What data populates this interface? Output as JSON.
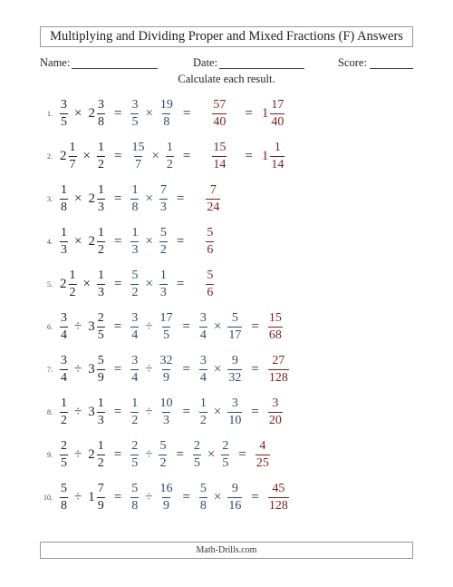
{
  "title": "Multiplying and Dividing Proper and Mixed Fractions (F) Answers",
  "header": {
    "name_label": "Name:",
    "date_label": "Date:",
    "score_label": "Score:"
  },
  "instructions": "Calculate each result.",
  "footer": "Math-Drills.com",
  "colors": {
    "problem": "#222222",
    "step": "#2e4a6b",
    "answer": "#7a1f1f"
  },
  "problems": [
    {
      "number": "1.",
      "segments": [
        {
          "type": "problem",
          "items": [
            {
              "f": [
                "3",
                "5"
              ]
            },
            {
              "op": "×"
            },
            {
              "w": "2",
              "f": [
                "3",
                "8"
              ]
            }
          ]
        },
        {
          "type": "step",
          "items": [
            {
              "f": [
                "3",
                "5"
              ]
            },
            {
              "op": "×"
            },
            {
              "f": [
                "19",
                "8"
              ]
            }
          ]
        },
        {
          "type": "answer",
          "items": [
            {
              "f": [
                "57",
                "40"
              ]
            }
          ]
        },
        {
          "type": "answer",
          "items": [
            {
              "w": "1",
              "f": [
                "17",
                "40"
              ]
            }
          ]
        }
      ]
    },
    {
      "number": "2.",
      "segments": [
        {
          "type": "problem",
          "items": [
            {
              "w": "2",
              "f": [
                "1",
                "7"
              ]
            },
            {
              "op": "×"
            },
            {
              "f": [
                "1",
                "2"
              ]
            }
          ]
        },
        {
          "type": "step",
          "items": [
            {
              "f": [
                "15",
                "7"
              ]
            },
            {
              "op": "×"
            },
            {
              "f": [
                "1",
                "2"
              ]
            }
          ]
        },
        {
          "type": "answer",
          "items": [
            {
              "f": [
                "15",
                "14"
              ]
            }
          ]
        },
        {
          "type": "answer",
          "items": [
            {
              "w": "1",
              "f": [
                "1",
                "14"
              ]
            }
          ]
        }
      ]
    },
    {
      "number": "3.",
      "segments": [
        {
          "type": "problem",
          "items": [
            {
              "f": [
                "1",
                "8"
              ]
            },
            {
              "op": "×"
            },
            {
              "w": "2",
              "f": [
                "1",
                "3"
              ]
            }
          ]
        },
        {
          "type": "step",
          "items": [
            {
              "f": [
                "1",
                "8"
              ]
            },
            {
              "op": "×"
            },
            {
              "f": [
                "7",
                "3"
              ]
            }
          ]
        },
        {
          "type": "answer",
          "items": [
            {
              "f": [
                "7",
                "24"
              ]
            }
          ]
        }
      ]
    },
    {
      "number": "4.",
      "segments": [
        {
          "type": "problem",
          "items": [
            {
              "f": [
                "1",
                "3"
              ]
            },
            {
              "op": "×"
            },
            {
              "w": "2",
              "f": [
                "1",
                "2"
              ]
            }
          ]
        },
        {
          "type": "step",
          "items": [
            {
              "f": [
                "1",
                "3"
              ]
            },
            {
              "op": "×"
            },
            {
              "f": [
                "5",
                "2"
              ]
            }
          ]
        },
        {
          "type": "answer",
          "items": [
            {
              "f": [
                "5",
                "6"
              ]
            }
          ]
        }
      ]
    },
    {
      "number": "5.",
      "segments": [
        {
          "type": "problem",
          "items": [
            {
              "w": "2",
              "f": [
                "1",
                "2"
              ]
            },
            {
              "op": "×"
            },
            {
              "f": [
                "1",
                "3"
              ]
            }
          ]
        },
        {
          "type": "step",
          "items": [
            {
              "f": [
                "5",
                "2"
              ]
            },
            {
              "op": "×"
            },
            {
              "f": [
                "1",
                "3"
              ]
            }
          ]
        },
        {
          "type": "answer",
          "items": [
            {
              "f": [
                "5",
                "6"
              ]
            }
          ]
        }
      ]
    },
    {
      "number": "6.",
      "segments": [
        {
          "type": "problem",
          "items": [
            {
              "f": [
                "3",
                "4"
              ]
            },
            {
              "op": "÷"
            },
            {
              "w": "3",
              "f": [
                "2",
                "5"
              ]
            }
          ]
        },
        {
          "type": "step",
          "items": [
            {
              "f": [
                "3",
                "4"
              ]
            },
            {
              "op": "÷"
            },
            {
              "f": [
                "17",
                "5"
              ]
            }
          ]
        },
        {
          "type": "step2",
          "items": [
            {
              "f": [
                "3",
                "4"
              ]
            },
            {
              "op": "×"
            },
            {
              "f": [
                "5",
                "17"
              ]
            }
          ]
        },
        {
          "type": "answer",
          "items": [
            {
              "f": [
                "15",
                "68"
              ]
            }
          ]
        }
      ]
    },
    {
      "number": "7.",
      "segments": [
        {
          "type": "problem",
          "items": [
            {
              "f": [
                "3",
                "4"
              ]
            },
            {
              "op": "÷"
            },
            {
              "w": "3",
              "f": [
                "5",
                "9"
              ]
            }
          ]
        },
        {
          "type": "step",
          "items": [
            {
              "f": [
                "3",
                "4"
              ]
            },
            {
              "op": "÷"
            },
            {
              "f": [
                "32",
                "9"
              ]
            }
          ]
        },
        {
          "type": "step2",
          "items": [
            {
              "f": [
                "3",
                "4"
              ]
            },
            {
              "op": "×"
            },
            {
              "f": [
                "9",
                "32"
              ]
            }
          ]
        },
        {
          "type": "answer",
          "items": [
            {
              "f": [
                "27",
                "128"
              ]
            }
          ]
        }
      ]
    },
    {
      "number": "8.",
      "segments": [
        {
          "type": "problem",
          "items": [
            {
              "f": [
                "1",
                "2"
              ]
            },
            {
              "op": "÷"
            },
            {
              "w": "3",
              "f": [
                "1",
                "3"
              ]
            }
          ]
        },
        {
          "type": "step",
          "items": [
            {
              "f": [
                "1",
                "2"
              ]
            },
            {
              "op": "÷"
            },
            {
              "f": [
                "10",
                "3"
              ]
            }
          ]
        },
        {
          "type": "step2",
          "items": [
            {
              "f": [
                "1",
                "2"
              ]
            },
            {
              "op": "×"
            },
            {
              "f": [
                "3",
                "10"
              ]
            }
          ]
        },
        {
          "type": "answer",
          "items": [
            {
              "f": [
                "3",
                "20"
              ]
            }
          ]
        }
      ]
    },
    {
      "number": "9.",
      "segments": [
        {
          "type": "problem",
          "items": [
            {
              "f": [
                "2",
                "5"
              ]
            },
            {
              "op": "÷"
            },
            {
              "w": "2",
              "f": [
                "1",
                "2"
              ]
            }
          ]
        },
        {
          "type": "step",
          "items": [
            {
              "f": [
                "2",
                "5"
              ]
            },
            {
              "op": "÷"
            },
            {
              "f": [
                "5",
                "2"
              ]
            }
          ]
        },
        {
          "type": "step2",
          "items": [
            {
              "f": [
                "2",
                "5"
              ]
            },
            {
              "op": "×"
            },
            {
              "f": [
                "2",
                "5"
              ]
            }
          ]
        },
        {
          "type": "answer",
          "items": [
            {
              "f": [
                "4",
                "25"
              ]
            }
          ]
        }
      ]
    },
    {
      "number": "10.",
      "segments": [
        {
          "type": "problem",
          "items": [
            {
              "f": [
                "5",
                "8"
              ]
            },
            {
              "op": "÷"
            },
            {
              "w": "1",
              "f": [
                "7",
                "9"
              ]
            }
          ]
        },
        {
          "type": "step",
          "items": [
            {
              "f": [
                "5",
                "8"
              ]
            },
            {
              "op": "÷"
            },
            {
              "f": [
                "16",
                "9"
              ]
            }
          ]
        },
        {
          "type": "step2",
          "items": [
            {
              "f": [
                "5",
                "8"
              ]
            },
            {
              "op": "×"
            },
            {
              "f": [
                "9",
                "16"
              ]
            }
          ]
        },
        {
          "type": "answer",
          "items": [
            {
              "f": [
                "45",
                "128"
              ]
            }
          ]
        }
      ]
    }
  ]
}
